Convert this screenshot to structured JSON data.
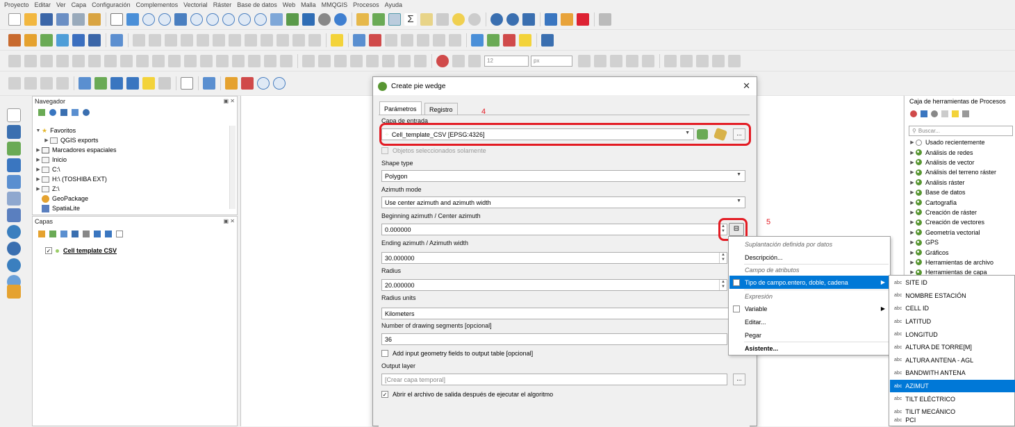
{
  "menubar": [
    "Proyecto",
    "Editar",
    "Ver",
    "Capa",
    "Configuración",
    "Complementos",
    "Vectorial",
    "Ráster",
    "Base de datos",
    "Web",
    "Malla",
    "MMQGIS",
    "Procesos",
    "Ayuda"
  ],
  "browser_panel": {
    "title": "Navegador",
    "items": [
      "Favoritos",
      "QGIS exports",
      "Marcadores espaciales",
      "Inicio",
      "C:\\",
      "H:\\ (TOSHIBA EXT)",
      "Z:\\",
      "GeoPackage",
      "SpatiaLite"
    ]
  },
  "layers_panel": {
    "title": "Capas",
    "layer_name": "Cell template CSV"
  },
  "dialog": {
    "title": "Create pie wedge",
    "tabs": [
      "Parámetros",
      "Registro"
    ],
    "input_layer_label": "Capa de entrada",
    "input_layer_value": "Cell_template_CSV [EPSG:4326]",
    "selected_only_label": "Objetos seleccionados solamente",
    "shape_type_label": "Shape type",
    "shape_type_value": "Polygon",
    "azimuth_mode_label": "Azimuth mode",
    "azimuth_mode_value": "Use center azimuth and azimuth width",
    "beginning_azimuth_label": "Beginning azimuth / Center azimuth",
    "beginning_azimuth_value": "0.000000",
    "ending_azimuth_label": "Ending azimuth / Azimuth width",
    "ending_azimuth_value": "30.000000",
    "radius_label": "Radius",
    "radius_value": "20.000000",
    "radius_units_label": "Radius units",
    "radius_units_value": "Kilometers",
    "segments_label": "Number of drawing segments [opcional]",
    "segments_value": "36",
    "add_input_label": "Add input geometry fields to output table [opcional]",
    "output_label": "Output layer",
    "output_placeholder": "[Crear capa temporal]",
    "open_output_label": "Abrir el archivo de salida después de ejecutar el algoritmo",
    "browse_label": "...",
    "annotation_4": "4",
    "annotation_5": "5"
  },
  "context_menu": {
    "header_data_override": "Suplantación definida por datos",
    "description": "Descripción...",
    "header_field": "Campo de atributos",
    "field_type": "Tipo de campo.entero, doble, cadena",
    "header_expression": "Expresión",
    "variable": "Variable",
    "edit": "Editar...",
    "paste": "Pegar",
    "assistant": "Asistente..."
  },
  "fields_submenu": {
    "type_badge": "abc",
    "items": [
      "SITE ID",
      "NOMBRE ESTACIÓN",
      "CELL ID",
      "LATITUD",
      "LONGITUD",
      "ALTURA DE TORRE[M]",
      "ALTURA ANTENA - AGL",
      "BANDWITH ANTENA",
      "AZIMUT",
      "TILT ELÉCTRICO",
      "TILIT MECÁNICO",
      "PCI"
    ],
    "selected": "AZIMUT"
  },
  "processing_panel": {
    "title": "Caja de herramientas de Procesos",
    "search_placeholder": "Buscar...",
    "items": [
      "Usado recientemente",
      "Análisis de redes",
      "Análisis de vector",
      "Análisis del terreno ráster",
      "Análisis ráster",
      "Base de datos",
      "Cartografía",
      "Creación de ráster",
      "Creación de vectores",
      "Geometría vectorial",
      "GPS",
      "Gráficos",
      "Herramientas de archivo",
      "Herramientas de capa"
    ]
  },
  "toolbar_misc": {
    "font_size": "12",
    "unit": "px"
  }
}
